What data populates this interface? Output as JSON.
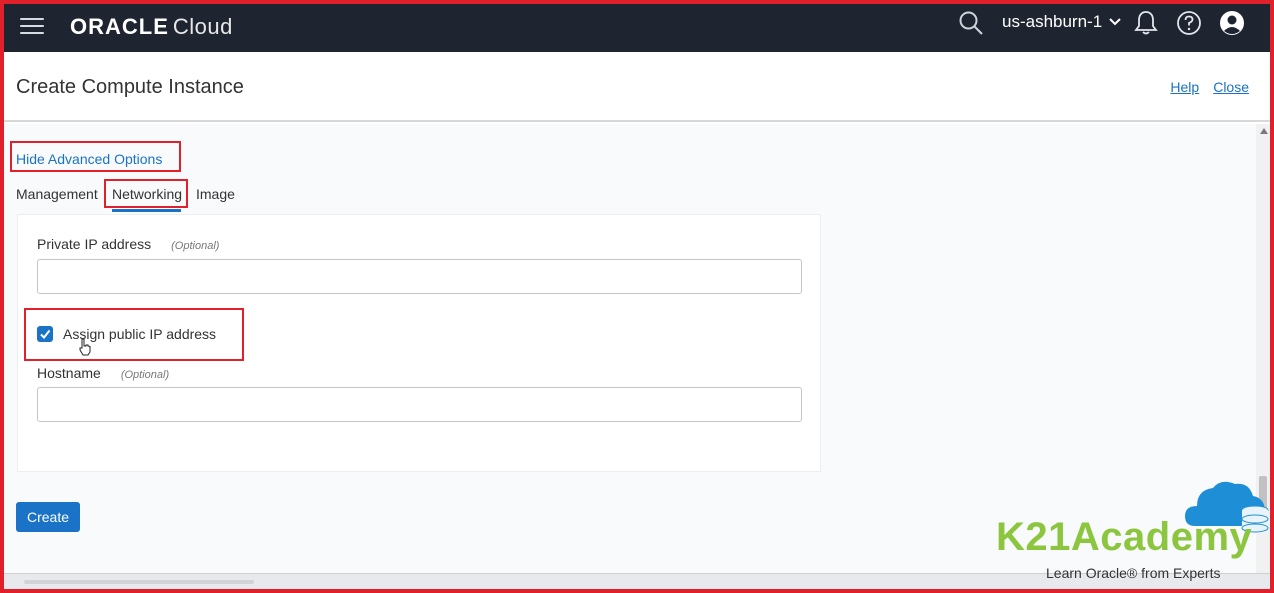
{
  "topbar": {
    "brand": "ORACLE",
    "product": "Cloud",
    "region": "us-ashburn-1"
  },
  "header": {
    "title": "Create Compute Instance",
    "help_link": "Help",
    "close_link": "Close"
  },
  "form": {
    "toggle_advanced": "Hide Advanced Options",
    "tabs": [
      {
        "label": "Management"
      },
      {
        "label": "Networking"
      },
      {
        "label": "Image"
      }
    ],
    "active_tab": "Networking",
    "private_ip": {
      "label": "Private IP address",
      "optional": "(Optional)",
      "value": ""
    },
    "assign_public_ip": {
      "label": "Assign public IP address",
      "checked": true
    },
    "hostname": {
      "label": "Hostname",
      "optional": "(Optional)",
      "value": ""
    },
    "create_button": "Create"
  },
  "watermark": {
    "title": "K21Academy",
    "subtitle": "Learn Oracle® from Experts"
  },
  "colors": {
    "topbar_bg": "#1f2431",
    "accent": "#1a73c6",
    "highlight": "#e0202a",
    "watermark_green": "#8cc63e"
  }
}
